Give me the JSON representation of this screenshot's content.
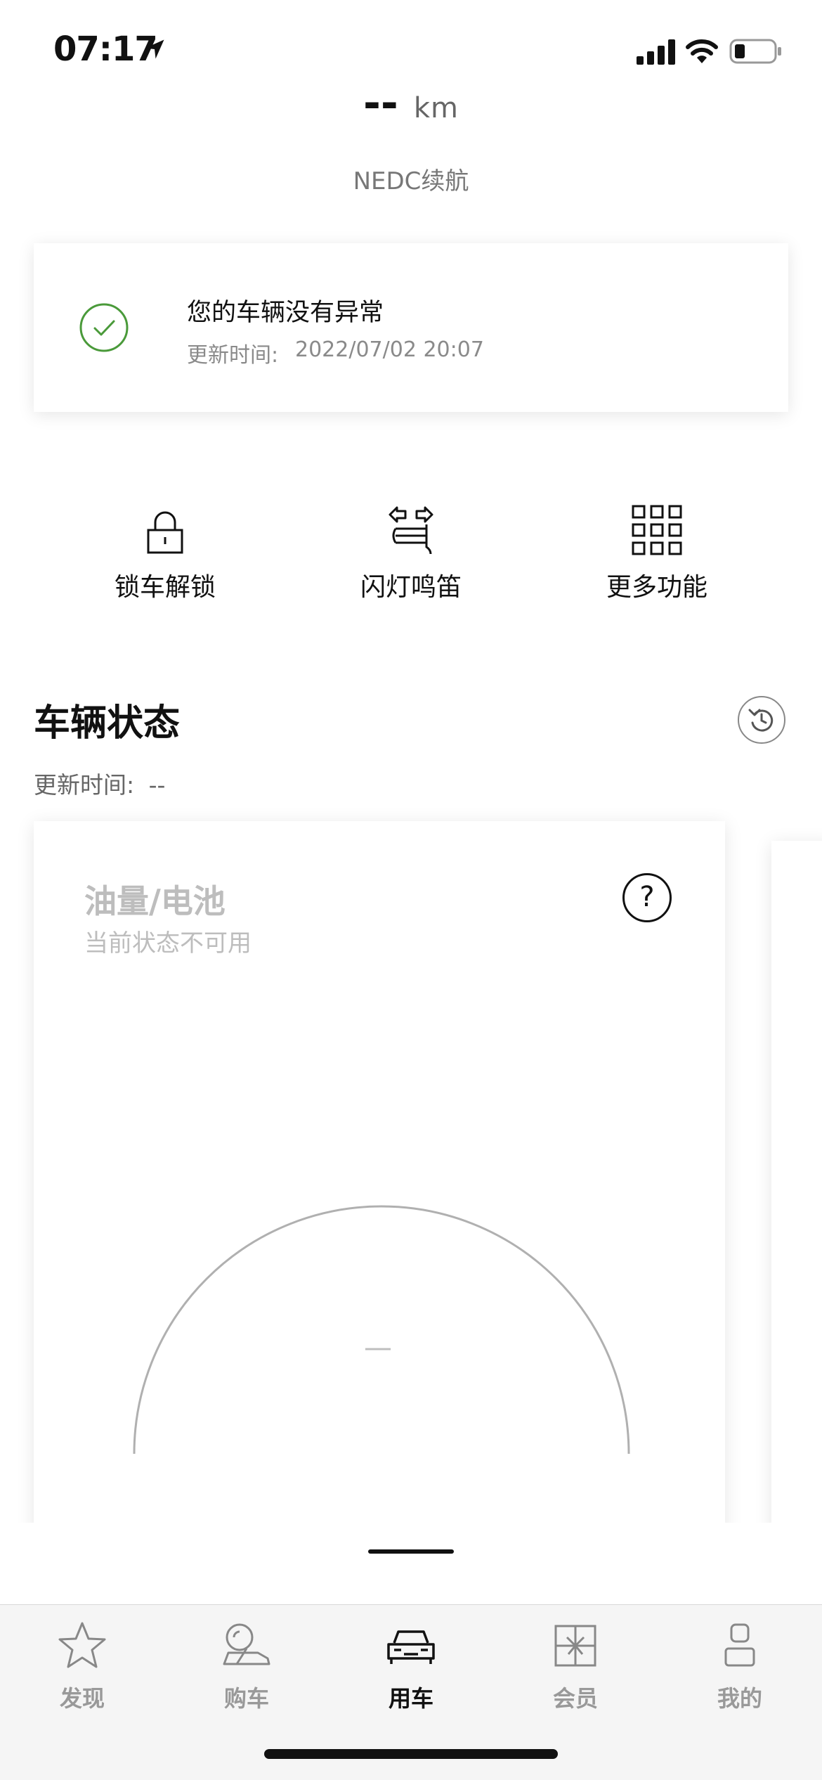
{
  "status_bar": {
    "time": "07:17",
    "icons": [
      "location-arrow-icon",
      "signal-icon",
      "wifi-icon",
      "battery-icon"
    ]
  },
  "range": {
    "value": "--",
    "unit": "km",
    "label": "NEDC续航"
  },
  "alert": {
    "title": "您的车辆没有异常",
    "time_label": "更新时间:",
    "time_value": "2022/07/02 20:07",
    "icon": "check-circle-icon",
    "accent": "#4a9a3a"
  },
  "actions": [
    {
      "label": "锁车解锁",
      "icon": "lock-icon"
    },
    {
      "label": "闪灯鸣笛",
      "icon": "flash-horn-icon"
    },
    {
      "label": "更多功能",
      "icon": "grid-icon"
    }
  ],
  "vehicle_status": {
    "title": "车辆状态",
    "update_label": "更新时间:",
    "update_value": "--",
    "refresh_icon": "refresh-icon"
  },
  "fuel_card": {
    "title": "油量/电池",
    "subtitle": "当前状态不可用",
    "help": "?",
    "gauge_value": "—"
  },
  "tabs": [
    {
      "label": "发现",
      "icon": "star-icon",
      "active": false
    },
    {
      "label": "购车",
      "icon": "buy-car-icon",
      "active": false
    },
    {
      "label": "用车",
      "icon": "car-icon",
      "active": true
    },
    {
      "label": "会员",
      "icon": "gift-icon",
      "active": false
    },
    {
      "label": "我的",
      "icon": "user-icon",
      "active": false
    }
  ]
}
